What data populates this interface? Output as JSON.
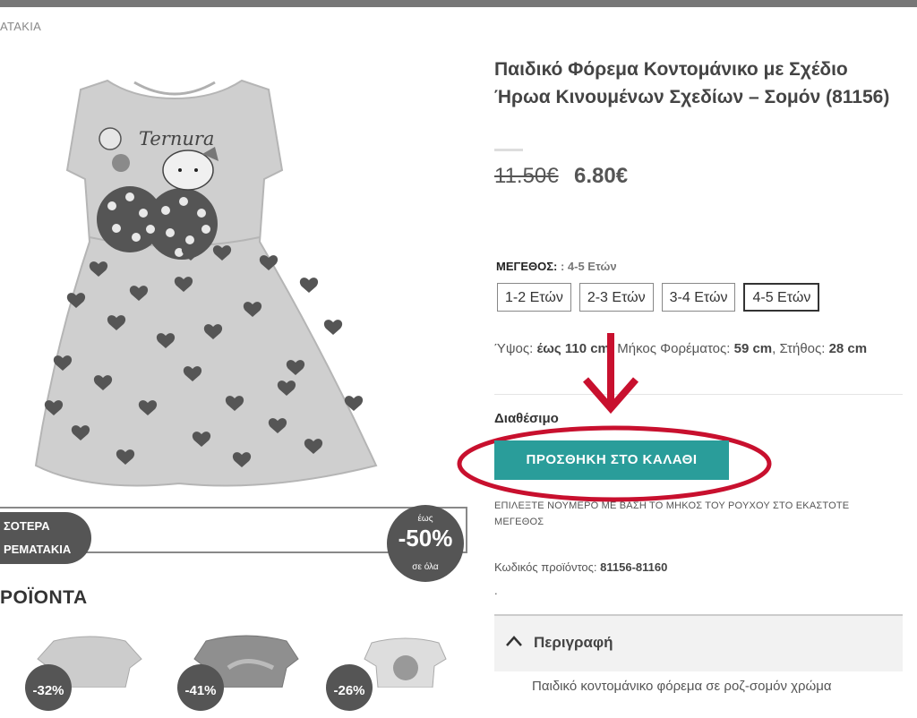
{
  "breadcrumb": "ΑΤΑΚΙΑ",
  "product": {
    "title": "Παιδικό Φόρεμα Κοντομάνικο με Σχέδιο Ήρωα Κινουμένων Σχεδίων – Σομόν (81156)",
    "price_old": "11.50€",
    "price_new": "6.80€",
    "image_text": "Ternura",
    "size_label": "ΜΕΓΕΘΟΣ:",
    "size_selected_text": ": 4-5 Ετών",
    "sizes": [
      "1-2 Ετών",
      "2-3 Ετών",
      "3-4 Ετών",
      "4-5 Ετών"
    ],
    "selected_size_index": 3,
    "dims": {
      "height_label": "Ύψος:",
      "height_value": "έως 110 cm",
      "length_label": "Μήκος Φορέματος:",
      "length_value": "59 cm",
      "chest_label": "Στήθος:",
      "chest_value": "28 cm"
    },
    "availability": "Διαθέσιμο",
    "add_to_cart": "ΠΡΟΣΘΗΚΗ ΣΤΟ ΚΑΛΑΘΙ",
    "note": "ΕΠΙΛΕΞΤΕ ΝΟΥΜΕΡΟ ΜΕ ΒΑΣΗ ΤΟ ΜΗΚΟΣ ΤΟΥ ΡΟΥΧΟΥ ΣΤΟ ΕΚΑΣΤΟΤΕ ΜΕΓΕΘΟΣ",
    "sku_label": "Κωδικός προϊόντος:",
    "sku_value": "81156-81160",
    "dot": ".",
    "tab_label": "Περιγραφή",
    "description": "Παιδικό κοντομάνικο φόρεμα σε ροζ-σομόν χρώμα"
  },
  "promo": {
    "line1": "ΣΟΤΕΡΑ",
    "line2": "ΡΕΜΑΤΑΚΙΑ",
    "upto": "έως",
    "discount": "-50%",
    "on_all": "σε όλα"
  },
  "related": {
    "title": "ΡΟΪΟΝΤΑ",
    "badges": [
      "-32%",
      "-41%",
      "-26%"
    ]
  },
  "colors": {
    "accent": "#2a9d9a",
    "annotation": "#c8102e"
  },
  "icons": {
    "chevron": "chevron-up-icon",
    "arrow": "arrow-down-icon"
  }
}
